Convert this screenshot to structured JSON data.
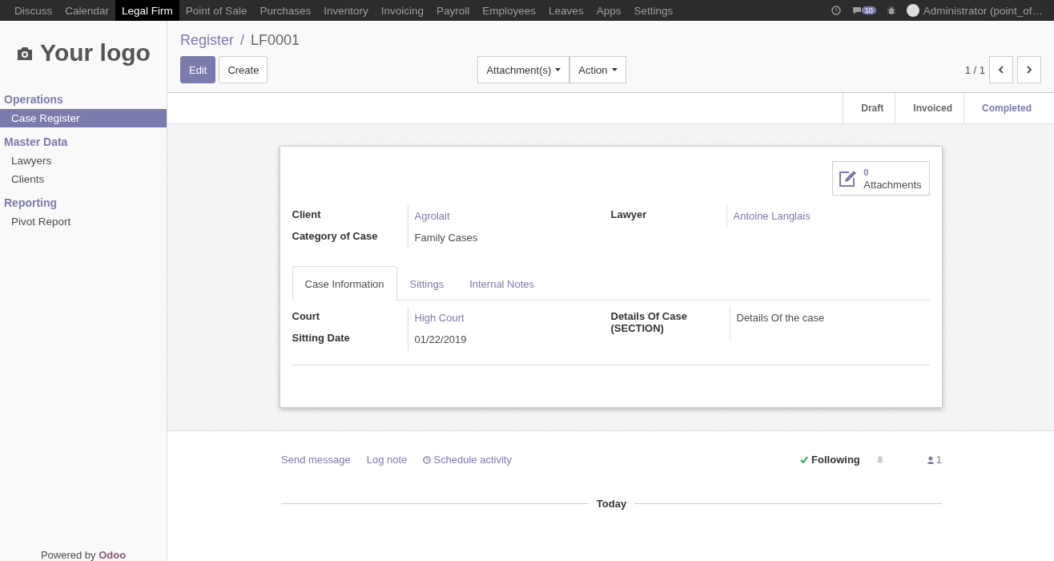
{
  "top_menu": {
    "items": [
      {
        "label": "Discuss",
        "selected": false
      },
      {
        "label": "Calendar",
        "selected": false
      },
      {
        "label": "Legal Firm",
        "selected": true
      },
      {
        "label": "Point of Sale",
        "selected": false
      },
      {
        "label": "Purchases",
        "selected": false
      },
      {
        "label": "Inventory",
        "selected": false
      },
      {
        "label": "Invoicing",
        "selected": false
      },
      {
        "label": "Payroll",
        "selected": false
      },
      {
        "label": "Employees",
        "selected": false
      },
      {
        "label": "Leaves",
        "selected": false
      },
      {
        "label": "Apps",
        "selected": false
      },
      {
        "label": "Settings",
        "selected": false
      }
    ],
    "messages_badge": "10",
    "user": "Administrator (point_of…"
  },
  "sidebar": {
    "logo": "Your logo",
    "sections": [
      {
        "title": "Operations",
        "items": [
          {
            "label": "Case Register",
            "selected": true
          }
        ]
      },
      {
        "title": "Master Data",
        "items": [
          {
            "label": "Lawyers",
            "selected": false
          },
          {
            "label": "Clients",
            "selected": false
          }
        ]
      },
      {
        "title": "Reporting",
        "items": [
          {
            "label": "Pivot Report",
            "selected": false
          }
        ]
      }
    ],
    "footer": "Powered by **Odoo**"
  },
  "breadcrumb": {
    "parent": "Register",
    "separator": "/",
    "current": "LF0001"
  },
  "buttons": [
    "Edit",
    "Create"
  ],
  "actions": [
    "Attachment(s)",
    "Action"
  ],
  "pager": "1 / 1",
  "statusbar": [
    {
      "label": "Draft",
      "selected": false
    },
    {
      "label": "Invoiced",
      "selected": false
    },
    {
      "label": "Completed",
      "selected": true
    }
  ],
  "sheet": {
    "attachments": {
      "count": "0",
      "label": "Attachments"
    },
    "groups": [
      [
        {
          "label": "Client",
          "value": "Agrolait",
          "kind": "link"
        },
        {
          "label": "Category of Case",
          "value": "Family Cases",
          "kind": "text"
        }
      ],
      [
        {
          "label": "Lawyer",
          "value": "Antoine Langlais",
          "kind": "link"
        }
      ]
    ],
    "tabs": [
      {
        "label": "Case Information",
        "selected": true
      },
      {
        "label": "Sittings",
        "selected": false
      },
      {
        "label": "Internal Notes",
        "selected": false
      }
    ],
    "tab_groups": [
      [
        {
          "label": "Court",
          "value": "High Court",
          "kind": "link"
        },
        {
          "label": "Sitting Date",
          "value": "01/22/2019",
          "kind": "text"
        }
      ],
      [
        {
          "label": "Details Of Case (SECTION)",
          "value": "Details Of the case",
          "kind": "text"
        }
      ]
    ]
  },
  "chatter": {
    "send_message": "Send message",
    "log_note": "Log note",
    "schedule_activity": "Schedule activity",
    "following": "Following",
    "followers": "1",
    "date_separator": "Today"
  }
}
